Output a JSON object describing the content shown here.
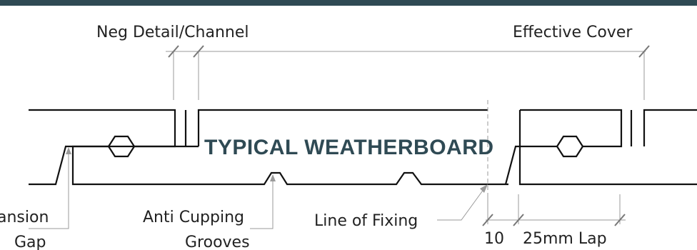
{
  "title": "TYPICAL WEATHERBOARD",
  "labels": {
    "neg_detail": "Neg Detail/Channel",
    "effective_cover": "Effective Cover",
    "expansion_line1": "ansion",
    "expansion_line2": "Gap",
    "anti_cupping_line1": "Anti Cupping",
    "anti_cupping_line2": "Grooves",
    "line_of_fixing": "Line of Fixing",
    "dim_10": "10",
    "lap": "25mm Lap"
  },
  "colors": {
    "header_bar": "#2f4a54",
    "title": "#2f4a54",
    "board_line": "#111111",
    "dimension_line": "#9a9a9a"
  }
}
